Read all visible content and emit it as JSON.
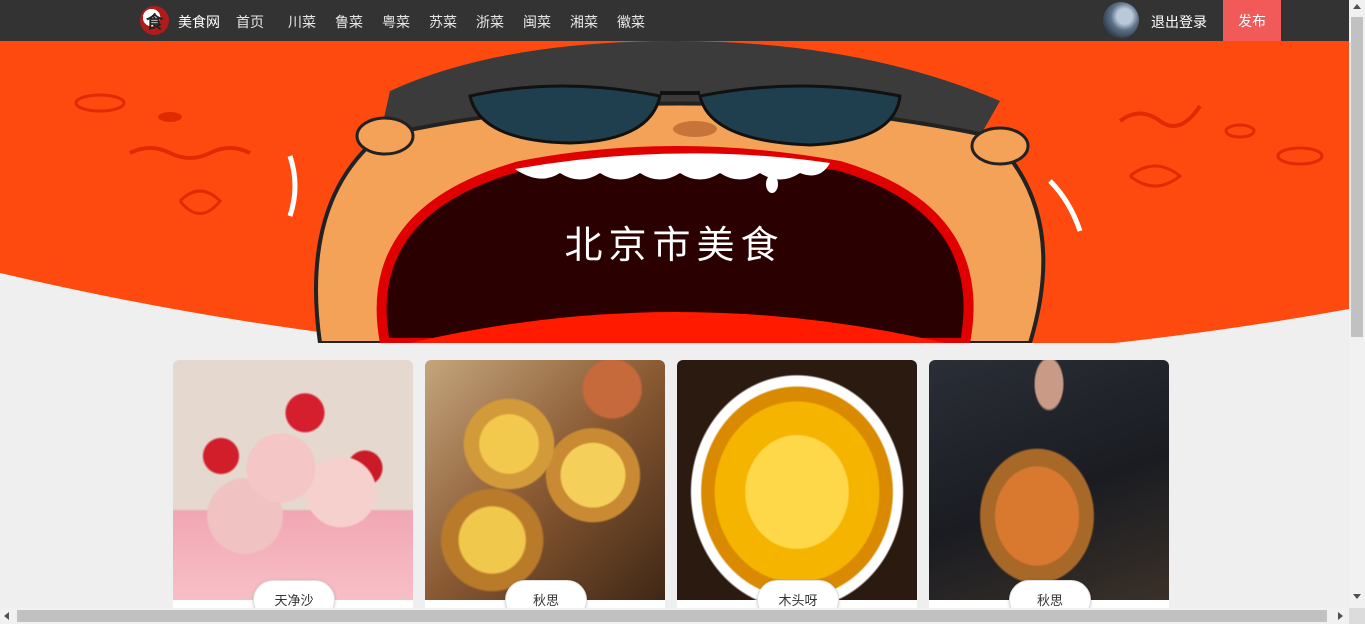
{
  "header": {
    "logo_glyph": "食",
    "site_name": "美食网",
    "nav": [
      "首页",
      "川菜",
      "鲁菜",
      "粤菜",
      "苏菜",
      "浙菜",
      "闽菜",
      "湘菜",
      "徽菜"
    ],
    "logout_label": "退出登录",
    "publish_label": "发布"
  },
  "banner": {
    "title": "北京市美食"
  },
  "cards": [
    {
      "author": "天净沙",
      "image": "strawberry-ice-cream"
    },
    {
      "author": "秋思",
      "image": "egg-tarts"
    },
    {
      "author": "木头呀",
      "image": "steamed-egg-custard"
    },
    {
      "author": "秋思",
      "image": "fried-food-basket"
    }
  ],
  "colors": {
    "topbar": "#333333",
    "publish": "#f25a5a",
    "banner_red": "#ff4a0f",
    "background": "#efefef"
  }
}
